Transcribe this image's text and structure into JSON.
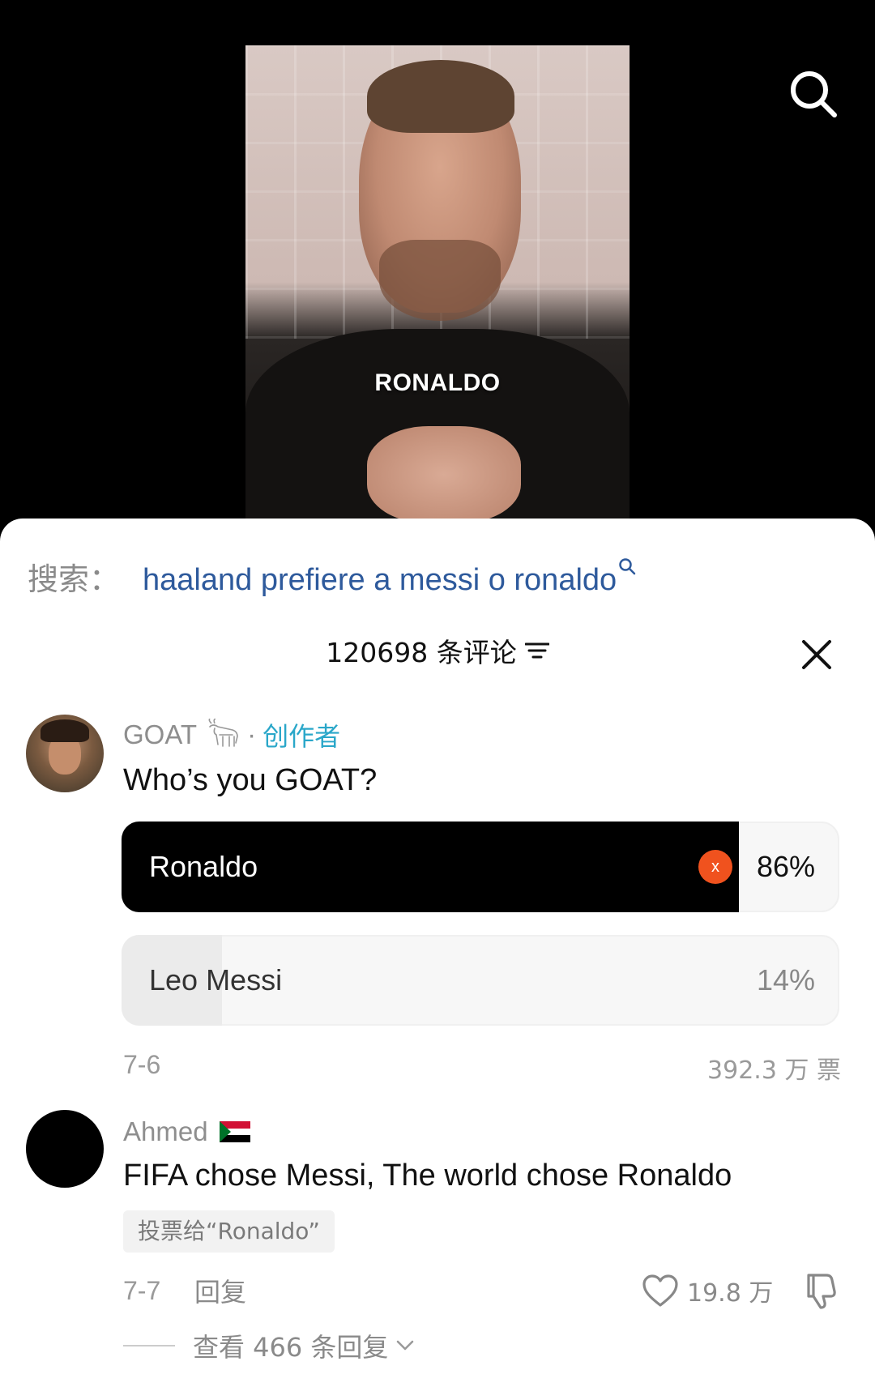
{
  "video": {
    "caption": "RONALDO"
  },
  "search": {
    "label": "搜索：",
    "term": "haaland prefiere a messi o ronaldo"
  },
  "comments": {
    "header": "120698 条评论"
  },
  "poll_post": {
    "author": "GOAT",
    "badge": "创作者",
    "question": "Who’s you GOAT?",
    "options": [
      {
        "label": "Ronaldo",
        "percent_text": "86%",
        "percent": 86,
        "voted": true
      },
      {
        "label": "Leo Messi",
        "percent_text": "14%",
        "percent": 14,
        "voted": false
      }
    ],
    "voted_mark": "x",
    "date": "7-6",
    "total_votes": "392.3 万 票"
  },
  "comment": {
    "user": "Ahmed",
    "flag": "sudan-flag",
    "text": "FIFA chose Messi, The world chose Ronaldo",
    "vote_tag": "投票给“Ronaldo”",
    "date": "7-7",
    "reply_label": "回复",
    "likes": "19.8 万",
    "view_replies": "查看 466 条回复"
  },
  "colors": {
    "accent_link": "#2e5a9c",
    "creator_badge": "#2aa7c9",
    "vote_mark": "#f0521e"
  }
}
